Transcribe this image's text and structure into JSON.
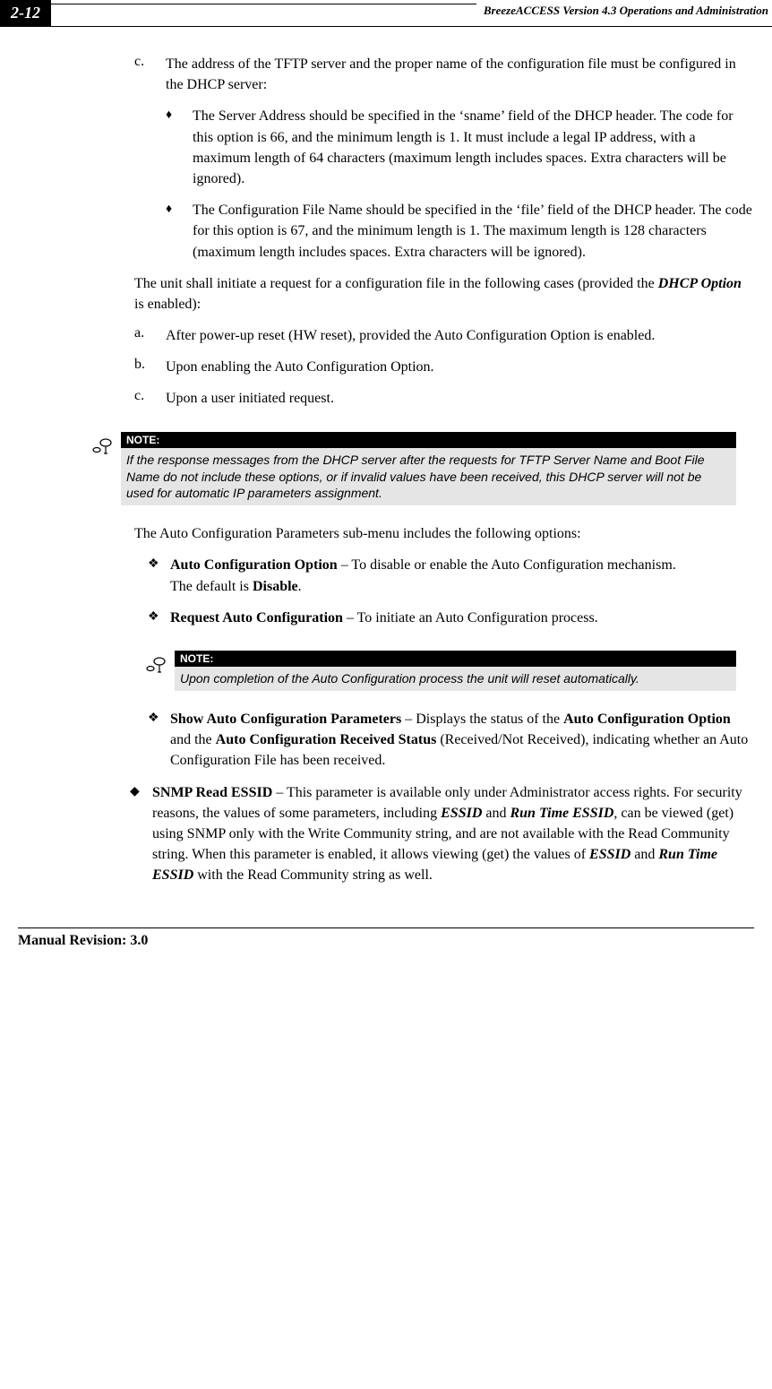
{
  "header": {
    "page_num": "2-12",
    "title": "BreezeACCESS Version 4.3 Operations and Administration"
  },
  "item_c": {
    "marker": "c.",
    "text": "The address of the TFTP server and the proper name of the configuration file must be configured in the DHCP server:"
  },
  "sub1": "The Server Address should be specified in the ‘sname’ field of the DHCP header. The code for this option is 66, and the minimum length is 1. It must include a legal IP address, with a maximum length of 64 characters (maximum length includes spaces. Extra characters will be ignored).",
  "sub2": "The Configuration File Name should be specified in the ‘file’ field of the DHCP header. The code for this option is 67, and the minimum length is 1. The maximum length is 128 characters (maximum length includes spaces. Extra characters will be ignored).",
  "intro_para_pre": "The unit shall initiate a request for a configuration file in the following cases (provided the ",
  "intro_para_bold": "DHCP Option",
  "intro_para_post": " is enabled):",
  "lista": {
    "marker": "a.",
    "text": "After power-up reset (HW reset), provided the Auto Configuration Option is enabled."
  },
  "listb": {
    "marker": "b.",
    "text": "Upon enabling the Auto Configuration Option."
  },
  "listc": {
    "marker": "c.",
    "text": "Upon a user initiated request."
  },
  "note1": {
    "label": "NOTE:",
    "text": "If the response messages from the DHCP server after the requests for TFTP Server Name and Boot File Name do not include these options, or if invalid values have been received, this DHCP server will not be used for automatic IP parameters assignment."
  },
  "para2": "The Auto Configuration Parameters sub-menu includes the following options:",
  "opt1_bold": "Auto Configuration Option",
  "opt1_rest": " – To disable or enable the Auto Configuration mechanism.",
  "opt1_default_pre": "The default is ",
  "opt1_default_bold": "Disable",
  "opt1_default_post": ".",
  "opt2_bold": "Request Auto Configuration",
  "opt2_rest": " – To initiate an Auto Configuration process.",
  "note2": {
    "label": "NOTE:",
    "text": "Upon completion of the Auto Configuration process the unit will reset automatically."
  },
  "opt3_bold": "Show Auto Configuration Parameters",
  "opt3_mid1": " – Displays the status of the ",
  "opt3_bold2": "Auto Configuration Option",
  "opt3_mid2": " and the ",
  "opt3_bold3": "Auto Configuration Received Status",
  "opt3_rest": " (Received/Not Received), indicating whether an Auto Configuration File has been received.",
  "snmp_bold": "SNMP Read ESSID",
  "snmp_mid1": " – This parameter is available only under Administrator access rights. For security reasons, the values of some parameters, including ",
  "snmp_bi1": "ESSID",
  "snmp_mid2": " and ",
  "snmp_bi2": "Run Time ESSID",
  "snmp_mid3": ", can be viewed (get) using SNMP only with the Write Community string, and are not available with the Read Community string. When this parameter is enabled, it allows viewing (get) the values of ",
  "snmp_bi3": "ESSID",
  "snmp_mid4": " and ",
  "snmp_bi4": "Run Time ESSID",
  "snmp_mid5": " with the Read Community string as well.",
  "footer": "Manual Revision: 3.0"
}
